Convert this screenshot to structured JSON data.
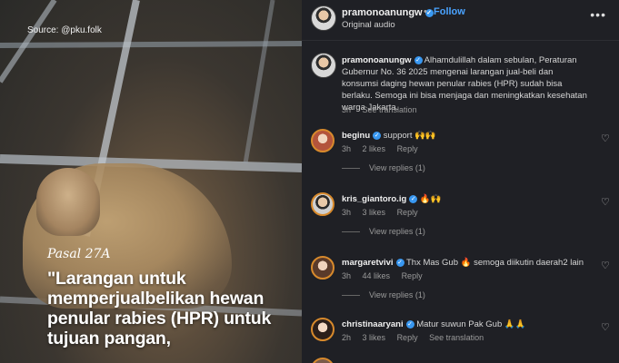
{
  "media": {
    "source": "Source: @pku.folk",
    "pasal": "Pasal 27A",
    "quote": "\"Larangan untuk memperjualbelikan hewan penular rabies (HPR) untuk tujuan pangan,"
  },
  "header": {
    "username": "pramonoanungw",
    "dot": "•",
    "follow": "Follow",
    "audio": "Original audio",
    "more": "•••"
  },
  "caption": {
    "username": "pramonoanungw",
    "text": "Alhamdulillah dalam sebulan, Peraturan Gubernur No. 36 2025 mengenai larangan jual-beli dan konsumsi daging hewan penular rabies (HPR) sudah bisa berlaku. Semoga ini bisa menjaga dan meningkatkan kesehatan warga Jakarta.",
    "time": "3h",
    "translate": "See translation"
  },
  "comments": [
    {
      "username": "beginu",
      "text": "support 🙌🙌",
      "time": "3h",
      "likes": "2 likes",
      "reply": "Reply",
      "view_replies": "View replies (1)",
      "extra": ""
    },
    {
      "username": "kris_giantoro.ig",
      "text": "🔥🙌",
      "time": "3h",
      "likes": "3 likes",
      "reply": "Reply",
      "view_replies": "View replies (1)",
      "extra": ""
    },
    {
      "username": "margaretvivi",
      "text": "Thx Mas Gub 🔥 semoga diikutin daerah2 lain",
      "time": "3h",
      "likes": "44 likes",
      "reply": "Reply",
      "view_replies": "View replies (1)",
      "extra": ""
    },
    {
      "username": "christinaaryani",
      "text": "Matur suwun Pak Gub 🙏🙏",
      "time": "2h",
      "likes": "3 likes",
      "reply": "Reply",
      "view_replies": "",
      "extra": "See translation"
    }
  ],
  "colors": {
    "panel_bg": "#1f2025",
    "link_blue": "#4aa3ff",
    "verified_blue": "#3897f0"
  },
  "icons": [
    "verified-badge-icon",
    "more-options-icon",
    "heart-icon"
  ]
}
